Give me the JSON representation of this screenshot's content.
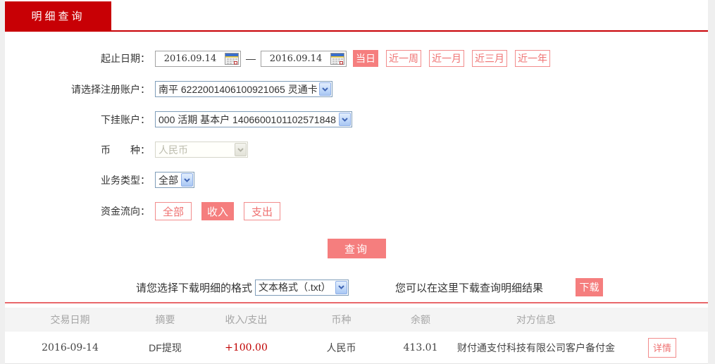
{
  "tab": {
    "label": "明细查询"
  },
  "form": {
    "date_range": {
      "label": "起止日期：",
      "start": "2016.09.14",
      "end": "2016.09.14",
      "separator": "—",
      "quick_buttons": [
        {
          "label": "当日",
          "active": true
        },
        {
          "label": "近一周",
          "active": false
        },
        {
          "label": "近一月",
          "active": false
        },
        {
          "label": "近三月",
          "active": false
        },
        {
          "label": "近一年",
          "active": false
        }
      ]
    },
    "register_account": {
      "label": "请选择注册账户：",
      "value": "南平 6222001406100921065 灵通卡"
    },
    "sub_account": {
      "label": "下挂账户：",
      "value": "000 活期 基本户 1406600101102571848"
    },
    "currency": {
      "label": "币　　种：",
      "value": "人民币",
      "disabled": true
    },
    "business_type": {
      "label": "业务类型：",
      "value": "全部"
    },
    "fund_flow": {
      "label": "资金流向：",
      "options": [
        {
          "label": "全部",
          "active": false
        },
        {
          "label": "收入",
          "active": true
        },
        {
          "label": "支出",
          "active": false
        }
      ]
    },
    "query_button": "查询"
  },
  "download": {
    "format_label": "请您选择下载明细的格式",
    "format_value": "文本格式（.txt）",
    "hint": "您可以在这里下载查询明细结果",
    "button": "下载"
  },
  "table": {
    "headers": [
      "交易日期",
      "摘要",
      "收入/支出",
      "币种",
      "余额",
      "对方信息"
    ],
    "rows": [
      {
        "date": "2016-09-14",
        "summary": "DF提现",
        "amount": "+100.00",
        "currency": "人民币",
        "balance": "413.01",
        "counterparty": "财付通支付科技有限公司客户备付金",
        "action": "详情"
      }
    ]
  },
  "colors": {
    "brand_red": "#c80005",
    "accent_salmon": "#f57e7e",
    "outline_salmon": "#f28c8c",
    "amount_red": "#c00000",
    "separator_red": "#e9686b"
  }
}
